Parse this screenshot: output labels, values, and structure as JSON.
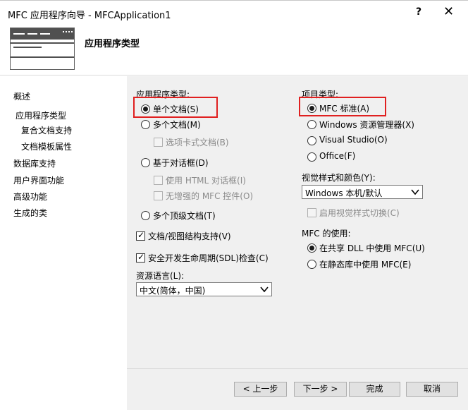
{
  "window": {
    "title": "MFC 应用程序向导 - MFCApplication1",
    "help_glyph": "?",
    "close_glyph": "✕"
  },
  "header": {
    "title": "应用程序类型",
    "icon": "window-wizard-icon"
  },
  "nav": {
    "items": [
      {
        "label": "概述"
      },
      {
        "label": "应用程序类型"
      },
      {
        "label": "复合文档支持"
      },
      {
        "label": "文档模板属性"
      },
      {
        "label": "数据库支持"
      },
      {
        "label": "用户界面功能"
      },
      {
        "label": "高级功能"
      },
      {
        "label": "生成的类"
      }
    ]
  },
  "app_type": {
    "group_label": "应用程序类型:",
    "single_doc": "单个文档(S)",
    "multi_doc": "多个文档(M)",
    "tabbed_docs": "选项卡式文档(B)",
    "dialog_based": "基于对话框(D)",
    "use_html_dialog": "使用 HTML 对话框(I)",
    "no_enhanced_mfc": "无增强的 MFC 控件(O)",
    "multi_toplevel": "多个顶级文档(T)",
    "doc_view_support": "文档/视图结构支持(V)",
    "sdl_checks": "安全开发生命周期(SDL)检查(C)",
    "resource_lang_label": "资源语言(L):",
    "resource_lang_value": "中文(简体，中国)"
  },
  "project_type": {
    "group_label": "项目类型:",
    "mfc_standard": "MFC 标准(A)",
    "windows_explorer": "Windows 资源管理器(X)",
    "visual_studio": "Visual Studio(O)",
    "office": "Office(F)"
  },
  "visual_style": {
    "label": "视觉样式和颜色(Y):",
    "value": "Windows 本机/默认",
    "enable_switch": "启用视觉样式切换(C)"
  },
  "mfc_usage": {
    "label": "MFC 的使用:",
    "shared_dll": "在共享 DLL 中使用 MFC(U)",
    "static_lib": "在静态库中使用 MFC(E)"
  },
  "buttons": {
    "prev": "< 上一步",
    "next": "下一步 >",
    "finish": "完成",
    "cancel": "取消"
  },
  "colors": {
    "highlight": "#e02020",
    "panel_bg": "#f0f0f0"
  }
}
